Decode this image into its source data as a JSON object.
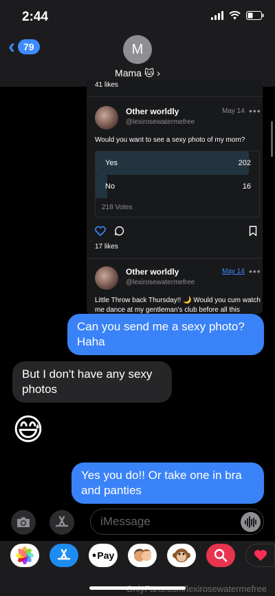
{
  "status_bar": {
    "time": "2:44"
  },
  "header": {
    "back_count": "79",
    "avatar_initial": "M",
    "contact_name": "Mama 🐱 ›"
  },
  "card": {
    "likes_top": "41 likes",
    "post1": {
      "name": "Other worldly",
      "handle": "@lexirosewatermefree",
      "date": "May 14",
      "more": "•••",
      "text": "Would you want to see a sexy photo of my mom?",
      "poll": [
        {
          "label": "Yes",
          "count": "202",
          "fraction": 0.93
        },
        {
          "label": "No",
          "count": "16",
          "fraction": 0.07
        }
      ],
      "votes": "218 Votes",
      "likes": "17 likes"
    },
    "post2": {
      "name": "Other worldly",
      "handle": "@lexirosewatermefree",
      "date": "May 14",
      "more": "•••",
      "text_line1": "Little Throw back Thursday!! 🌙 Would you cum watch",
      "text_line2": "me dance at my gentleman's club before all this"
    }
  },
  "messages": {
    "m1": "Can you send me a sexy photo? Haha",
    "m2": "But I don't have any sexy photos",
    "m3": "😅",
    "m4": "Yes you do!! Or take one in bra and panties"
  },
  "input": {
    "placeholder": "iMessage"
  },
  "apps": [
    "photos-app-icon",
    "app-store-icon",
    "apple-pay-icon",
    "memoji-icon",
    "animoji-monkey-icon",
    "search-images-icon",
    "digital-touch-icon"
  ],
  "apple_pay_label": "Pay",
  "watermark": "OnlyFans.com/lexirosewatermefree",
  "colors": {
    "accent": "#3a82f7",
    "header_bg": "#1c1c1e",
    "received": "#262628"
  }
}
